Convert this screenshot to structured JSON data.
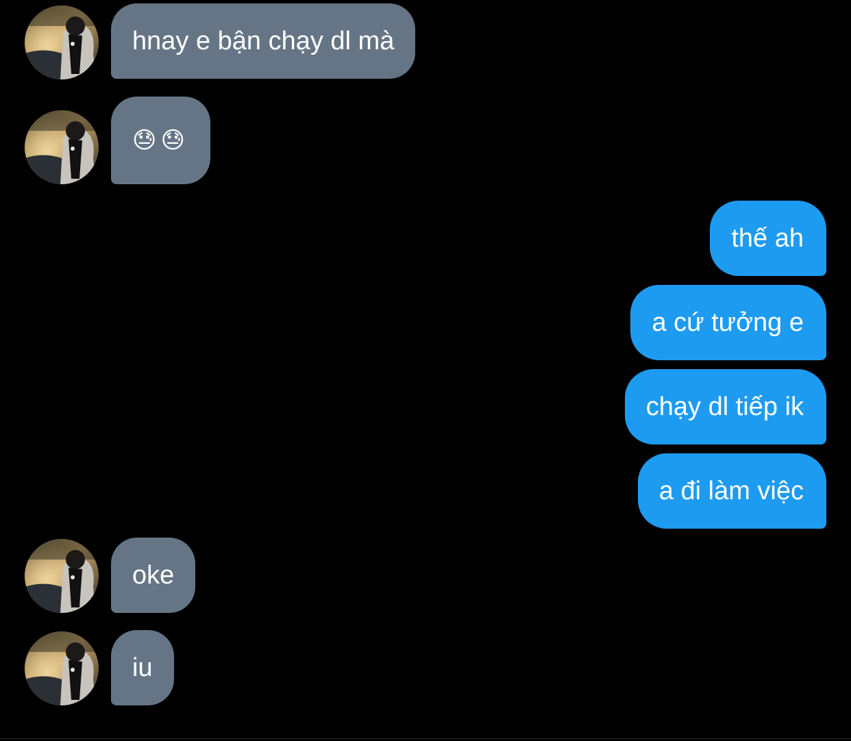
{
  "conversation": {
    "messages": [
      {
        "sender": "other",
        "text": "hnay e bận chạy dl mà"
      },
      {
        "sender": "other",
        "text": "😓😓"
      },
      {
        "sender": "me",
        "text": "thế ah"
      },
      {
        "sender": "me",
        "text": "a cứ tưởng e"
      },
      {
        "sender": "me",
        "text": "chạy dl tiếp ik"
      },
      {
        "sender": "me",
        "text": "a đi làm việc"
      },
      {
        "sender": "other",
        "text": "oke"
      },
      {
        "sender": "other",
        "text": "iu"
      }
    ]
  },
  "colors": {
    "background": "#000000",
    "incoming_bubble": "#657586",
    "outgoing_bubble": "#1d9bf0",
    "text": "#ffffff"
  },
  "icons": {
    "avatar": "contact-avatar-photo"
  }
}
